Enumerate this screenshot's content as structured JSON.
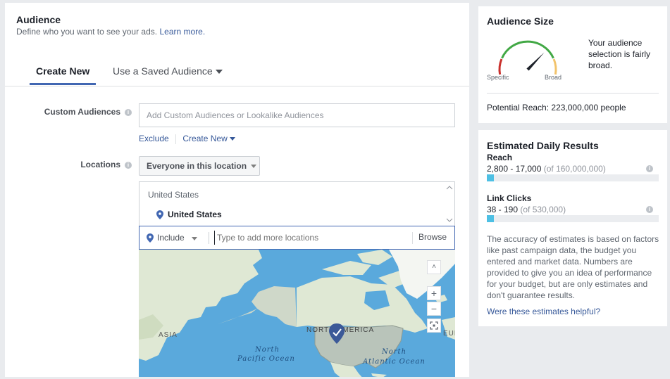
{
  "audience": {
    "title": "Audience",
    "subtitle": "Define who you want to see your ads.",
    "learn_more": "Learn more.",
    "tabs": [
      {
        "label": "Create New"
      },
      {
        "label": "Use a Saved Audience"
      }
    ],
    "custom_audiences": {
      "label": "Custom Audiences",
      "placeholder": "Add Custom Audiences or Lookalike Audiences",
      "exclude": "Exclude",
      "create_new": "Create New"
    },
    "locations": {
      "label": "Locations",
      "dropdown": "Everyone in this location",
      "group_header": "United States",
      "selected": "United States",
      "include": "Include",
      "placeholder": "Type to add more locations",
      "browse": "Browse"
    },
    "map": {
      "labels": {
        "asia": "ASIA",
        "north_america": "NORTH AMERICA",
        "pacific_1": "North",
        "pacific_2": "Pacific Ocean",
        "atlantic_1": "North",
        "atlantic_2": "Atlantic Ocean",
        "europe": "EURO"
      },
      "zoom_in": "+",
      "zoom_out": "−",
      "scroll_up": "˄"
    }
  },
  "audience_size": {
    "title": "Audience Size",
    "description": "Your audience selection is fairly broad.",
    "specific": "Specific",
    "broad": "Broad",
    "potential_reach": "Potential Reach: 223,000,000 people",
    "meter_level": 0.72,
    "colors": {
      "red": "#c9302c",
      "green": "#42a845",
      "yellow": "#f2c36b",
      "needle": "#1d2129"
    }
  },
  "estimates": {
    "title": "Estimated Daily Results",
    "reach": {
      "label": "Reach",
      "range": "2,800 - 17,000",
      "of": "(of 160,000,000)",
      "fill": 0.04
    },
    "clicks": {
      "label": "Link Clicks",
      "range": "38 - 190",
      "of": "(of 530,000)",
      "fill": 0.04
    },
    "disclaimer": "The accuracy of estimates is based on factors like past campaign data, the budget you entered and market data. Numbers are provided to give you an idea of performance for your budget, but are only estimates and don't guarantee results.",
    "helpful": "Were these estimates helpful?"
  },
  "colors": {
    "accent": "#4267b2",
    "link": "#365899",
    "bar": "#4ec0e4",
    "water": "#5aa9dc",
    "land": "#dfe8d4"
  }
}
